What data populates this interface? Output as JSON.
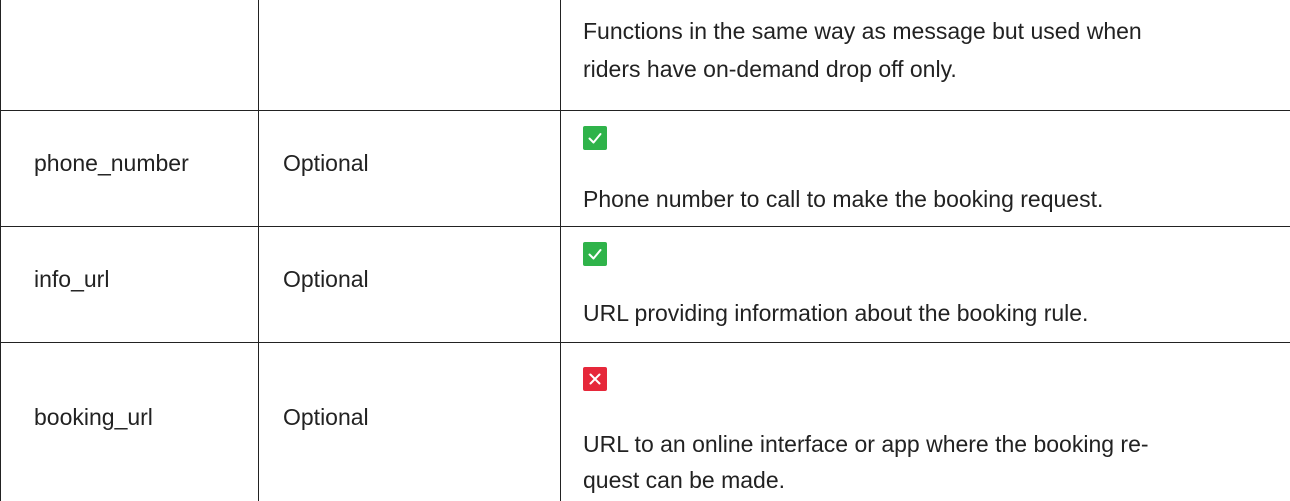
{
  "rows": [
    {
      "field": "",
      "presence": "",
      "status": "",
      "description_lines": [
        "Functions in the same way as message but used when",
        "riders have on-demand drop off only."
      ]
    },
    {
      "field": "phone_number",
      "presence": "Optional",
      "status": "supported",
      "status_icon": "check-icon",
      "description_lines": [
        "Phone number to call to make the booking request."
      ]
    },
    {
      "field": "info_url",
      "presence": "Optional",
      "status": "supported",
      "status_icon": "check-icon",
      "description_lines": [
        "URL providing information about the booking rule."
      ]
    },
    {
      "field": "booking_url",
      "presence": "Optional",
      "status": "not-supported",
      "status_icon": "cross-icon",
      "description_lines": [
        "URL to an online interface or app where the booking re-",
        "quest can be made."
      ]
    }
  ],
  "colors": {
    "check": "#2fb34a",
    "cross": "#e6283a",
    "border": "#222222",
    "text": "#222222"
  }
}
